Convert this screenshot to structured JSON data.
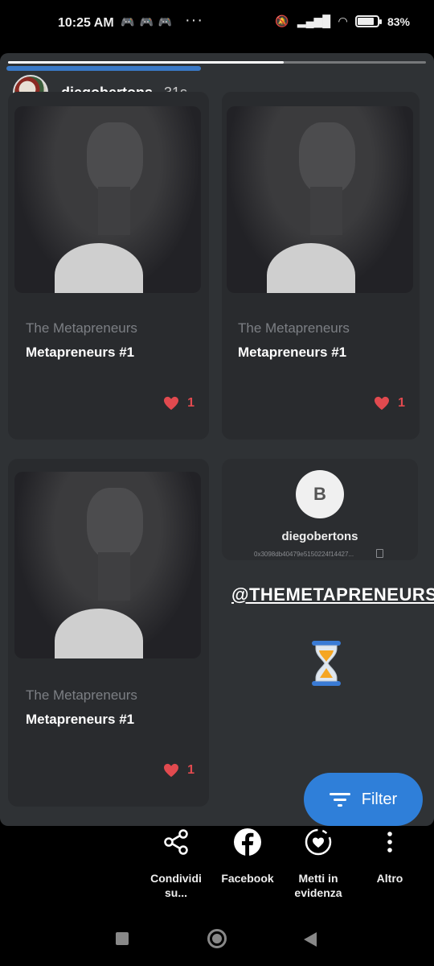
{
  "status_bar": {
    "time": "10:25 AM",
    "notification_icons": [
      "game-icon",
      "game-icon",
      "game-icon"
    ],
    "more": "···",
    "battery": "83",
    "battery_unit": "%",
    "battery_level": 0.83
  },
  "story": {
    "progress_fraction": 0.66,
    "author": {
      "username": "diegobertons",
      "time_ago": "31s"
    },
    "cards": [
      {
        "collection": "The Metapreneurs",
        "name": "Metapreneurs #1",
        "likes": "1"
      },
      {
        "collection": "The Metapreneurs",
        "name": "Metapreneurs #1",
        "likes": "1"
      },
      {
        "collection": "The Metapreneurs",
        "name": "Metapreneurs #1",
        "likes": "1"
      }
    ],
    "profile": {
      "logo_letter": "B",
      "name": "diegobertons",
      "address": "0x3098db40479e5150224f14427..."
    },
    "mention": "@THEMETAPRENEURS",
    "filter_label": "Filter"
  },
  "share_actions": [
    {
      "label": "Condividi su...",
      "icon": "share-icon"
    },
    {
      "label": "Facebook",
      "icon": "facebook-icon"
    },
    {
      "label": "Metti in evidenza",
      "icon": "highlight-heart-icon"
    },
    {
      "label": "Altro",
      "icon": "more-vertical-icon"
    }
  ],
  "colors": {
    "accent": "#2f7fd9",
    "heart": "#e14a4f",
    "card_bg": "#292b2e"
  }
}
